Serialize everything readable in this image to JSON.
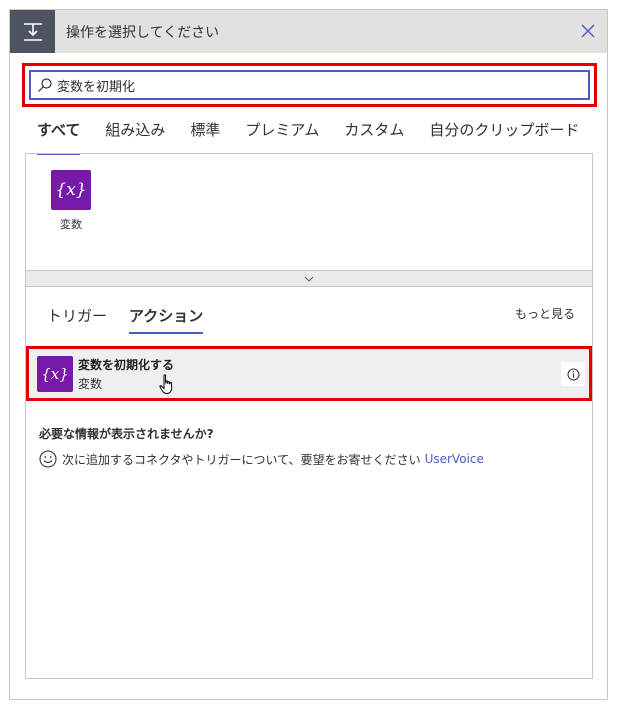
{
  "header": {
    "title": "操作を選択してください",
    "icon": "insert-step-icon"
  },
  "search": {
    "value": "変数を初期化",
    "placeholder": ""
  },
  "tabs": [
    {
      "label": "すべて",
      "active": true
    },
    {
      "label": "組み込み",
      "active": false
    },
    {
      "label": "標準",
      "active": false
    },
    {
      "label": "プレミアム",
      "active": false
    },
    {
      "label": "カスタム",
      "active": false
    },
    {
      "label": "自分のクリップボード",
      "active": false
    }
  ],
  "connectors": [
    {
      "label": "変数",
      "icon": "variable-icon",
      "icon_text": "{x}",
      "color": "#7719aa"
    }
  ],
  "subtabs": [
    {
      "label": "トリガー",
      "active": false
    },
    {
      "label": "アクション",
      "active": true
    }
  ],
  "more_label": "もっと見る",
  "action": {
    "title": "変数を初期化する",
    "subtitle": "変数",
    "icon_text": "{x}"
  },
  "help": {
    "question": "必要な情報が表示されませんか?",
    "feedback_text": "次に追加するコネクタやトリガーについて、要望をお寄せください",
    "link": "UserVoice"
  },
  "colors": {
    "accent": "#4b5dc5",
    "highlight": "#e00000",
    "variable": "#7719aa",
    "header_bg": "#e1e1e1",
    "header_icon_bg": "#4d5360"
  }
}
